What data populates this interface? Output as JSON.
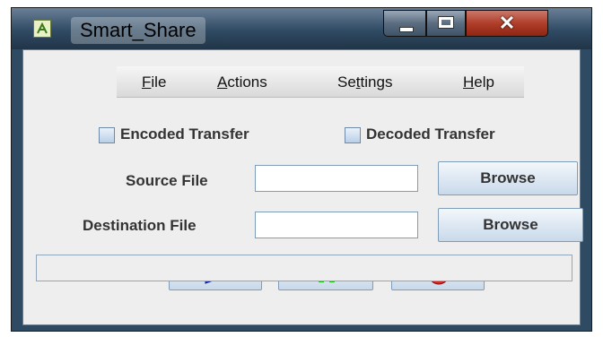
{
  "window": {
    "title": "Smart_Share"
  },
  "menu": [
    {
      "label": "File",
      "mnemonic": "F",
      "rest": "ile"
    },
    {
      "label": "Actions",
      "mnemonic": "A",
      "rest": "ctions"
    },
    {
      "label": "Settings",
      "pre": "Se",
      "mnemonic": "t",
      "rest": "tings"
    },
    {
      "label": "Help",
      "mnemonic": "H",
      "rest": "elp"
    }
  ],
  "options": {
    "encoded_label": "Encoded Transfer",
    "encoded_checked": false,
    "decoded_label": "Decoded Transfer",
    "decoded_checked": false
  },
  "source": {
    "label": "Source File",
    "value": "",
    "browse_label": "Browse"
  },
  "destination": {
    "label": "Destination File",
    "value": "",
    "browse_label": "Browse"
  },
  "controls": [
    {
      "name": "play",
      "icon": "play-icon",
      "color": "#1f3fe0"
    },
    {
      "name": "pause",
      "icon": "pause-icon",
      "color": "#22c01a"
    },
    {
      "name": "stop",
      "icon": "stop-icon",
      "color": "#d62b2b"
    }
  ],
  "status": {
    "text": ""
  }
}
